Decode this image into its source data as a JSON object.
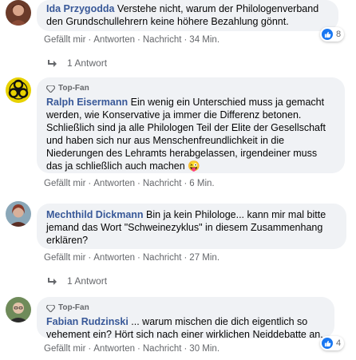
{
  "comments": [
    {
      "author": "Ida Przygodda",
      "text": "Verstehe nicht, warum der Philologenverband den Grundschullehrern keine höhere Bezahlung gönnt.",
      "actions": [
        "Gefällt mir",
        "Antworten",
        "Nachricht"
      ],
      "time": "34 Min.",
      "reactions": "8",
      "replies": "1 Antwort"
    },
    {
      "badge": "Top-Fan",
      "author": "Ralph Eisermann",
      "text": "Ein wenig ein Unterschied muss ja gemacht werden, wie Konservative ja immer die Differenz betonen. Schließlich sind ja alle Philologen Teil der Elite der Gesellschaft und haben sich nur aus Menschenfreundlichkeit in die Niederungen des Lehramts herabgelassen, irgendeiner muss das ja schließlich auch machen 😜",
      "actions": [
        "Gefällt mir",
        "Antworten",
        "Nachricht"
      ],
      "time": "6 Min."
    },
    {
      "author": "Mechthild Dickmann",
      "text": "Bin ja kein Philologe... kann mir mal bitte jemand das Wort \"Schweinezyklus\" in diesem Zusammenhang erklären?",
      "actions": [
        "Gefällt mir",
        "Antworten",
        "Nachricht"
      ],
      "time": "27 Min.",
      "replies": "1 Antwort"
    },
    {
      "badge": "Top-Fan",
      "author": "Fabian Rudzinski",
      "text": "... warum mischen die dich eigentlich so vehement ein? Hört sich nach einer wirklichen Neiddebatte an.",
      "actions": [
        "Gefällt mir",
        "Antworten",
        "Nachricht"
      ],
      "time": "30 Min.",
      "reactions": "4"
    }
  ],
  "colors": {
    "link": "#385898",
    "like": "#1877f2",
    "bubble": "#f0f2f5"
  },
  "icons": {
    "badge": "diamond-icon",
    "reply": "reply-arrow-icon",
    "reaction": "thumbs-up-icon"
  }
}
